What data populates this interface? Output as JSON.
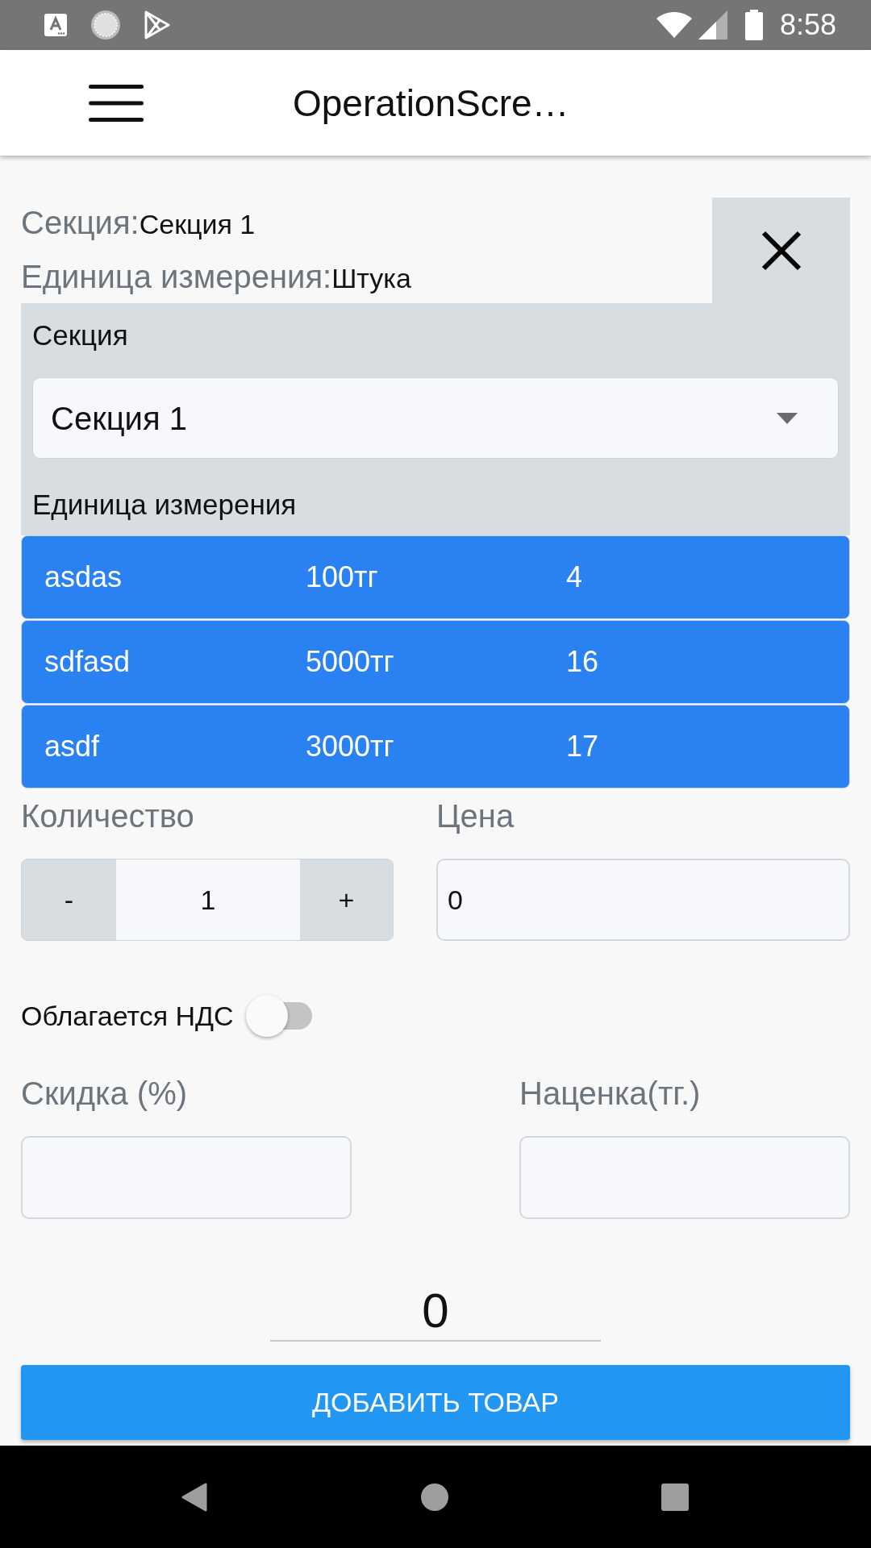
{
  "status_bar": {
    "time": "8:58"
  },
  "app_bar": {
    "title": "OperationScre…"
  },
  "summary": {
    "section_label": "Секция:",
    "section_value": "Секция 1",
    "unit_label": "Единица измерения:",
    "unit_value": "Штука"
  },
  "section_panel": {
    "section_label": "Секция",
    "section_select": {
      "value": "Секция 1"
    },
    "unit_label": "Единица измерения"
  },
  "units": [
    {
      "name": "asdas",
      "price": "100тг",
      "column_3": "4"
    },
    {
      "name": "sdfasd",
      "price": "5000тг",
      "column_3": "16"
    },
    {
      "name": "asdf",
      "price": "3000тг",
      "column_3": "17"
    }
  ],
  "quantity": {
    "label": "Количество",
    "minus": "-",
    "value": "1",
    "plus": "+"
  },
  "price": {
    "label": "Цена",
    "value": "0"
  },
  "vat": {
    "label": "Облагается НДС",
    "on": false
  },
  "discount": {
    "label": "Скидка (%)"
  },
  "markup": {
    "label": "Наценка(тг.)"
  },
  "total": {
    "value": "0"
  },
  "add_button": {
    "label": "ДОБАВИТЬ ТОВАР"
  }
}
